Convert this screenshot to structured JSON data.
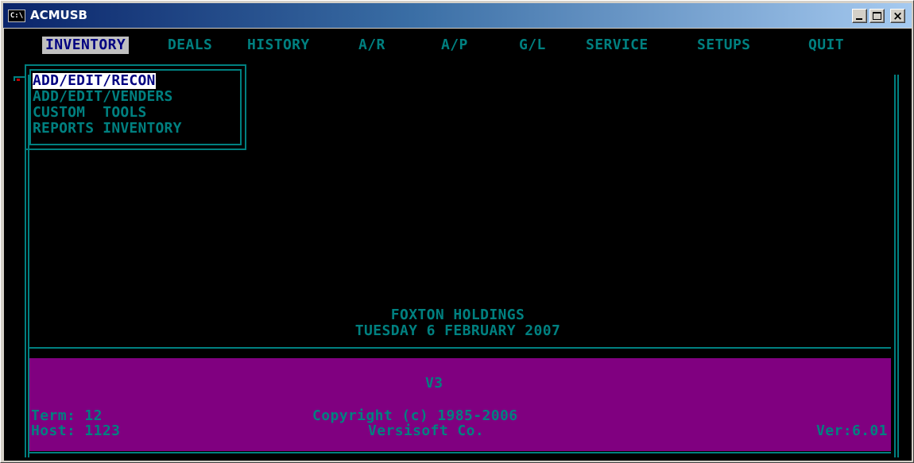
{
  "window": {
    "title": "ACMUSB",
    "icon_text": "C:\\"
  },
  "menu": {
    "items": [
      {
        "label": "INVENTORY",
        "active": true
      },
      {
        "label": "DEALS",
        "active": false
      },
      {
        "label": "HISTORY",
        "active": false
      },
      {
        "label": "A/R",
        "active": false
      },
      {
        "label": "A/P",
        "active": false
      },
      {
        "label": "G/L",
        "active": false
      },
      {
        "label": "SERVICE",
        "active": false
      },
      {
        "label": "SETUPS",
        "active": false
      },
      {
        "label": "QUIT",
        "active": false
      }
    ]
  },
  "submenu": {
    "items": [
      {
        "label": "ADD/EDIT/RECON",
        "selected": true
      },
      {
        "label": "ADD/EDIT/VENDERS",
        "selected": false
      },
      {
        "label": "CUSTOM  TOOLS",
        "selected": false
      },
      {
        "label": "REPORTS INVENTORY",
        "selected": false
      }
    ]
  },
  "center": {
    "company": "FOXTON HOLDINGS",
    "date": "TUESDAY 6 FEBRUARY 2007"
  },
  "status": {
    "version_code": "V3",
    "term": "Term: 12",
    "host": "Host: 1123",
    "copyright": "Copyright (c) 1985-2006",
    "company": "Versisoft Co.",
    "version": "Ver:6.01"
  },
  "colors": {
    "console_bg": "#000000",
    "teal": "#008080",
    "panel": "#800080",
    "highlight": "#ffffff",
    "active_menu_bg": "#c0c0c0",
    "active_menu_fg": "#000080"
  }
}
